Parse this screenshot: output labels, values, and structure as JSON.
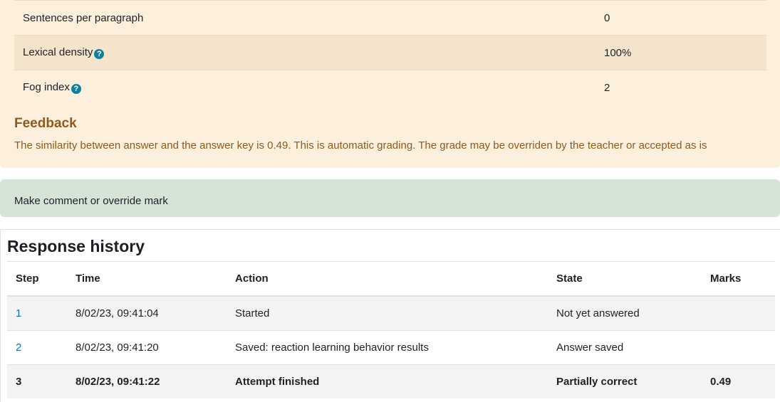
{
  "stats": [
    {
      "label": "Sentences per paragraph",
      "value": "0",
      "help": false
    },
    {
      "label": "Lexical density",
      "value": "100%",
      "help": true
    },
    {
      "label": "Fog index",
      "value": "2",
      "help": true
    }
  ],
  "help_glyph": "?",
  "feedback": {
    "heading": "Feedback",
    "text": "The similarity between answer and the answer key is 0.49. This is automatic grading. The grade may be overriden by the teacher or accepted as is"
  },
  "comment": {
    "link_label": "Make comment or override mark"
  },
  "history": {
    "title": "Response history",
    "columns": [
      "Step",
      "Time",
      "Action",
      "State",
      "Marks"
    ],
    "rows": [
      {
        "step": "1",
        "time": "8/02/23, 09:41:04",
        "action": "Started",
        "state": "Not yet answered",
        "marks": ""
      },
      {
        "step": "2",
        "time": "8/02/23, 09:41:20",
        "action": "Saved: reaction learning behavior results",
        "state": "Answer saved",
        "marks": ""
      },
      {
        "step": "3",
        "time": "8/02/23, 09:41:22",
        "action": "Attempt finished",
        "state": "Partially correct",
        "marks": "0.49"
      }
    ]
  },
  "colors": {
    "feedback_bg": "#fcefdc",
    "feedback_text": "#8c5b1d",
    "comment_bg": "#d6e4d7",
    "link": "#0f6cbf",
    "help_icon": "#0e7f9f"
  }
}
